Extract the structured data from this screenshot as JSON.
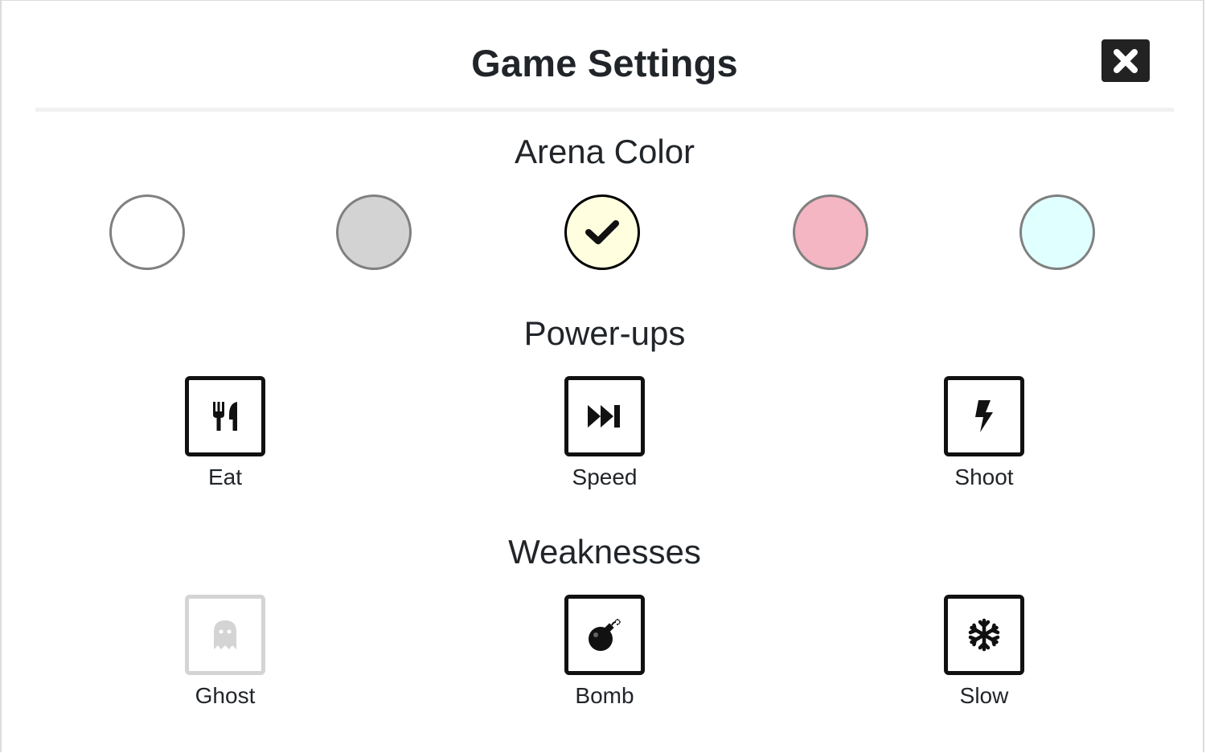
{
  "modal": {
    "title": "Game Settings",
    "close_icon": "close-icon"
  },
  "arena_color": {
    "heading": "Arena Color",
    "swatches": [
      {
        "color": "#ffffff",
        "selected": false
      },
      {
        "color": "#d3d3d3",
        "selected": false
      },
      {
        "color": "#ffffe0",
        "selected": true
      },
      {
        "color": "#f4b6c2",
        "selected": false
      },
      {
        "color": "#e0ffff",
        "selected": false
      }
    ],
    "selected_icon": "checkmark-icon"
  },
  "powerups": {
    "heading": "Power-ups",
    "items": [
      {
        "label": "Eat",
        "icon": "utensils-icon",
        "enabled": true
      },
      {
        "label": "Speed",
        "icon": "fast-forward-icon",
        "enabled": true
      },
      {
        "label": "Shoot",
        "icon": "bolt-icon",
        "enabled": true
      }
    ]
  },
  "weaknesses": {
    "heading": "Weaknesses",
    "items": [
      {
        "label": "Ghost",
        "icon": "ghost-icon",
        "enabled": false
      },
      {
        "label": "Bomb",
        "icon": "bomb-icon",
        "enabled": true
      },
      {
        "label": "Slow",
        "icon": "snowflake-icon",
        "enabled": true
      }
    ]
  },
  "colors": {
    "text": "#212529",
    "tile_border": "#111111",
    "tile_border_disabled": "#d4d4d4",
    "swatch_border": "#808080",
    "swatch_selected_border": "#000000"
  }
}
